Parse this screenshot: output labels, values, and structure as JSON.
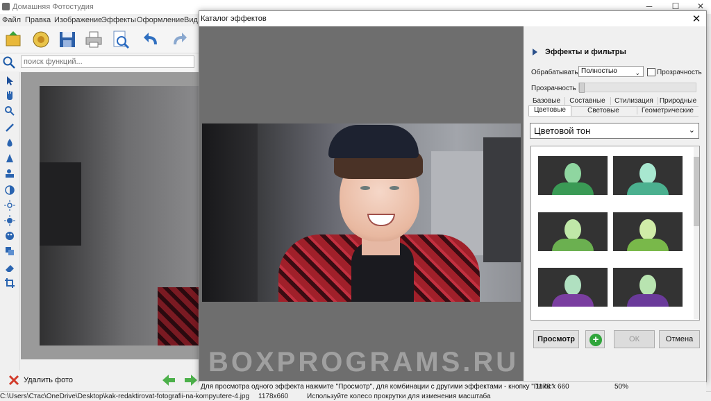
{
  "app": {
    "title": "Домашняя Фотостудия"
  },
  "window_controls": {
    "minimize": "─",
    "maximize": "☐",
    "close": "✕"
  },
  "menu": [
    "Файл",
    "Правка",
    "Изображение",
    "Эффекты",
    "Оформление",
    "Вид"
  ],
  "toolbar": {
    "icons": [
      "open-icon",
      "effects-icon",
      "save-icon",
      "print-icon",
      "preview-icon",
      "undo-icon",
      "redo-icon"
    ]
  },
  "search": {
    "placeholder": "поиск функций..."
  },
  "left_status": {
    "delete_label": "Удалить фото"
  },
  "bottombar": {
    "path": "C:\\Users\\Стас\\OneDrive\\Desktop\\kak-redaktirovat-fotografii-na-kompyutere-4.jpg",
    "size": "1178x660",
    "hint": "Используйте колесо прокрутки для изменения масштаба"
  },
  "dialog": {
    "title": "Каталог эффектов",
    "close": "✕",
    "panel_title": "Эффекты и фильтры",
    "process_label": "Обрабатывать",
    "process_value": "Полностью",
    "transparency_checkbox": "Прозрачность",
    "transparency_label": "Прозрачность",
    "tabs_row1": [
      "Базовые",
      "Составные",
      "Стилизация",
      "Природные"
    ],
    "tabs_row2": [
      "Цветовые",
      "Световые",
      "Геометрические"
    ],
    "selected_tab": "Цветовые",
    "category": "Цветовой тон",
    "buttons": {
      "preview": "Просмотр",
      "plus": "+",
      "ok": "ОК",
      "cancel": "Отмена"
    },
    "status": {
      "hint": "Для просмотра одного эффекта нажмите \"Просмотр\", для комбинации с другими эффектами - кнопку \"Плюс\"",
      "size": "1178 x 660",
      "zoom": "50%"
    }
  },
  "thumbnail_tints": [
    "#3a9a55",
    "#4bb08f",
    "#6bb050",
    "#79b84a",
    "#3d9c6a",
    "#5a8f3a"
  ],
  "watermark": "BOXPROGRAMS.RU"
}
